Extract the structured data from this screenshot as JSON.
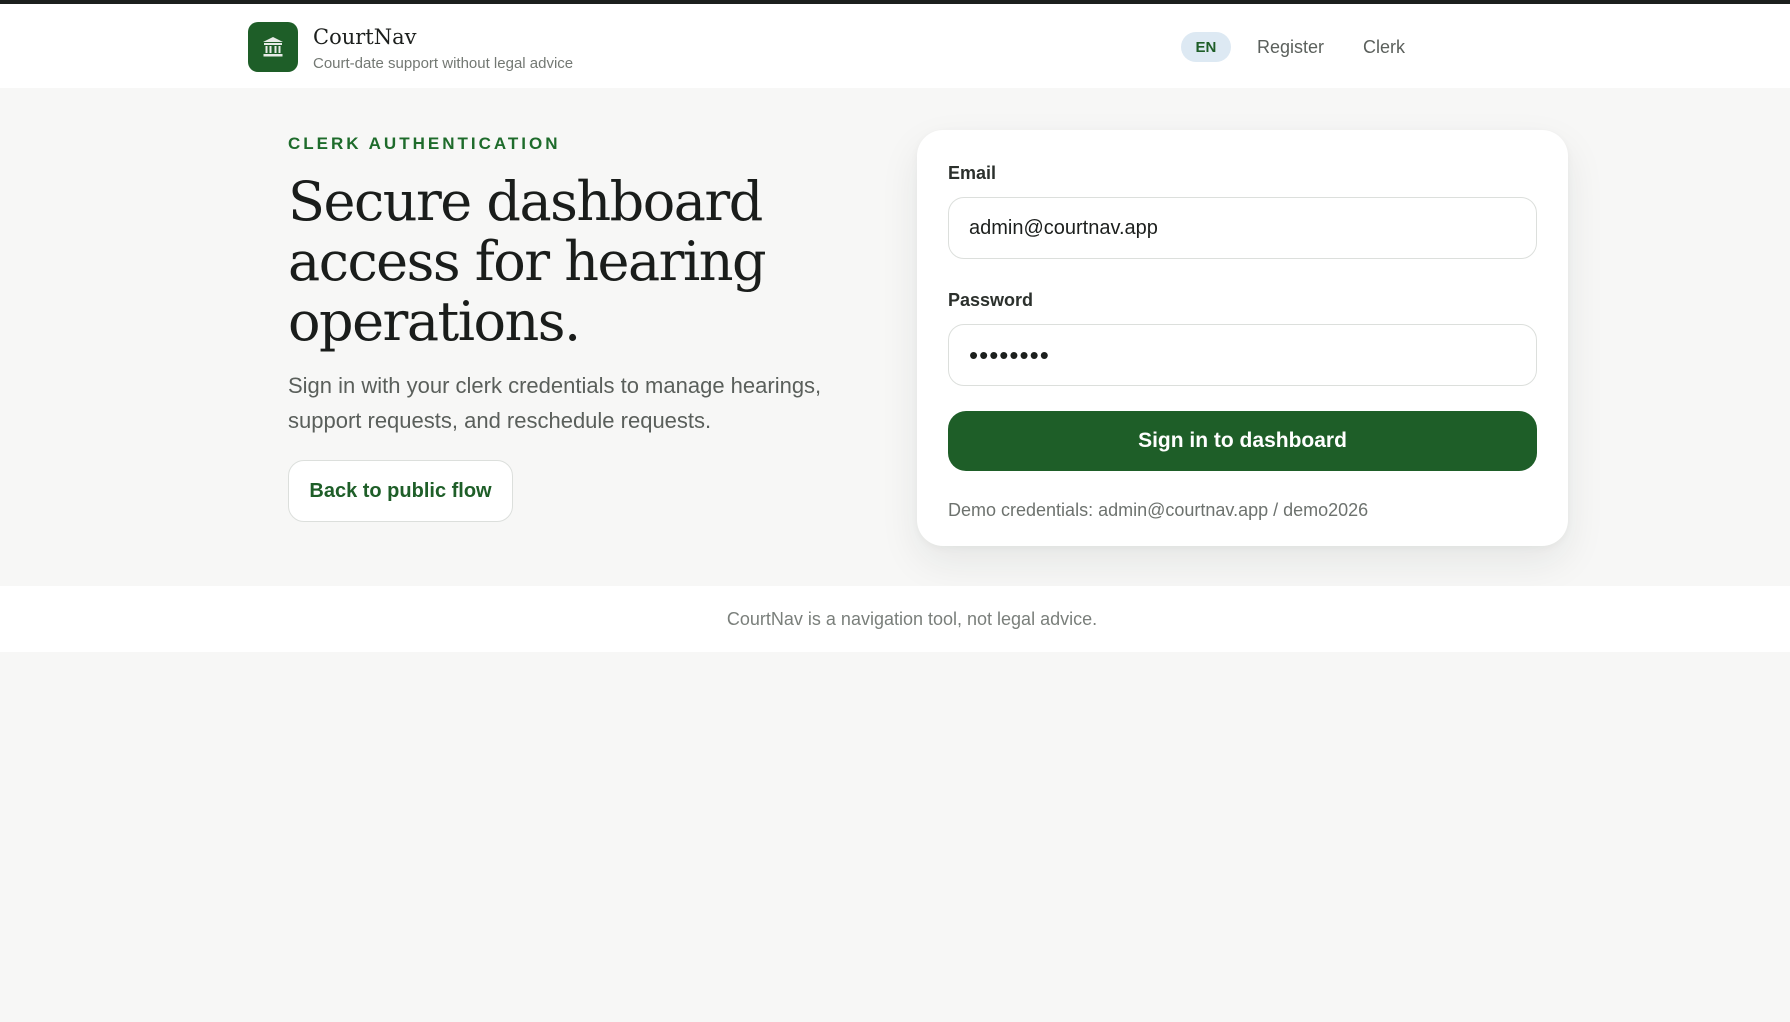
{
  "brand": {
    "name": "CourtNav",
    "tagline": "Court-date support without legal advice",
    "logo_icon": "courthouse-icon",
    "accent_color": "#1e5e28"
  },
  "nav": {
    "language": "EN",
    "register_label": "Register",
    "clerk_label": "Clerk"
  },
  "hero": {
    "eyebrow": "CLERK AUTHENTICATION",
    "headline": "Secure dashboard access for hearing operations.",
    "lede": "Sign in with your clerk credentials to manage hearings, support requests, and reschedule requests.",
    "back_label": "Back to public flow"
  },
  "login": {
    "email_label": "Email",
    "email_value": "admin@courtnav.app",
    "password_label": "Password",
    "password_value": "demo2026",
    "password_display": "••••••••",
    "submit_label": "Sign in to dashboard",
    "demo_note": "Demo credentials: admin@courtnav.app / demo2026"
  },
  "footer": {
    "text": "CourtNav is a navigation tool, not legal advice."
  }
}
